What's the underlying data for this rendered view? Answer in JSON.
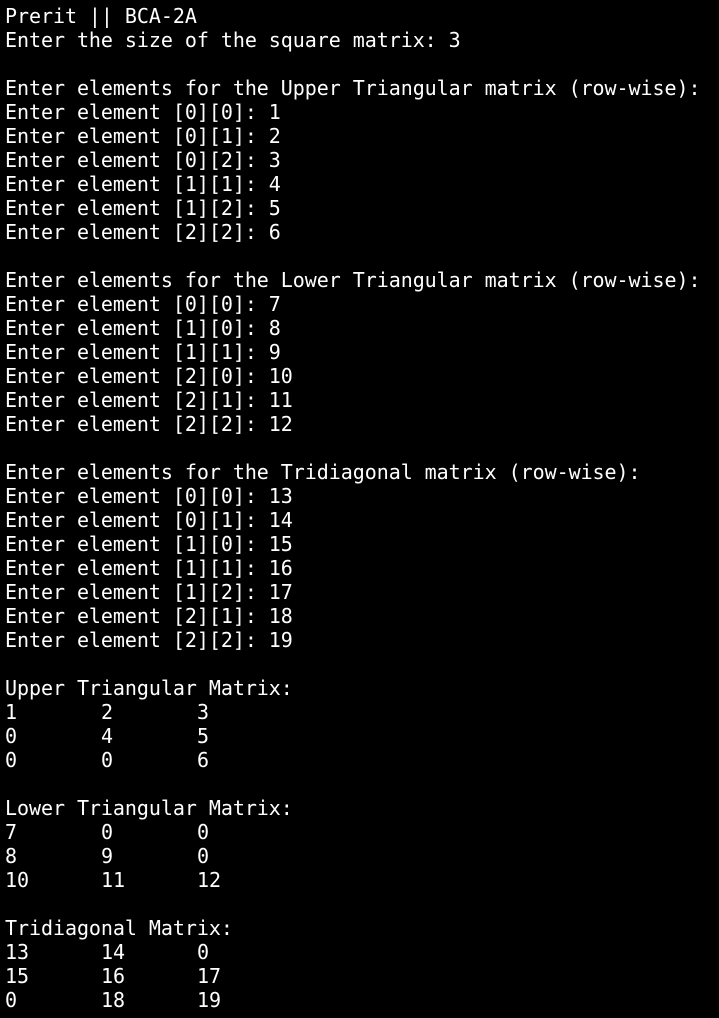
{
  "terminal": {
    "background": "#000000",
    "foreground": "#ffffff",
    "header": "Prerit || BCA-2A",
    "size_prompt": "Enter the size of the square matrix: 3",
    "upper_input": {
      "heading": "Enter elements for the Upper Triangular matrix (row-wise):",
      "lines": [
        "Enter element [0][0]: 1",
        "Enter element [0][1]: 2",
        "Enter element [0][2]: 3",
        "Enter element [1][1]: 4",
        "Enter element [1][2]: 5",
        "Enter element [2][2]: 6"
      ]
    },
    "lower_input": {
      "heading": "Enter elements for the Lower Triangular matrix (row-wise):",
      "lines": [
        "Enter element [0][0]: 7",
        "Enter element [1][0]: 8",
        "Enter element [1][1]: 9",
        "Enter element [2][0]: 10",
        "Enter element [2][1]: 11",
        "Enter element [2][2]: 12"
      ]
    },
    "tri_input": {
      "heading": "Enter elements for the Tridiagonal matrix (row-wise):",
      "lines": [
        "Enter element [0][0]: 13",
        "Enter element [0][1]: 14",
        "Enter element [1][0]: 15",
        "Enter element [1][1]: 16",
        "Enter element [1][2]: 17",
        "Enter element [2][1]: 18",
        "Enter element [2][2]: 19"
      ]
    },
    "upper_matrix": {
      "heading": "Upper Triangular Matrix:",
      "rows": [
        [
          "1",
          "2",
          "3"
        ],
        [
          "0",
          "4",
          "5"
        ],
        [
          "0",
          "0",
          "6"
        ]
      ]
    },
    "lower_matrix": {
      "heading": "Lower Triangular Matrix:",
      "rows": [
        [
          "7",
          "0",
          "0"
        ],
        [
          "8",
          "9",
          "0"
        ],
        [
          "10",
          "11",
          "12"
        ]
      ]
    },
    "tri_matrix": {
      "heading": "Tridiagonal Matrix:",
      "rows": [
        [
          "13",
          "14",
          "0"
        ],
        [
          "15",
          "16",
          "17"
        ],
        [
          "0",
          "18",
          "19"
        ]
      ]
    }
  }
}
